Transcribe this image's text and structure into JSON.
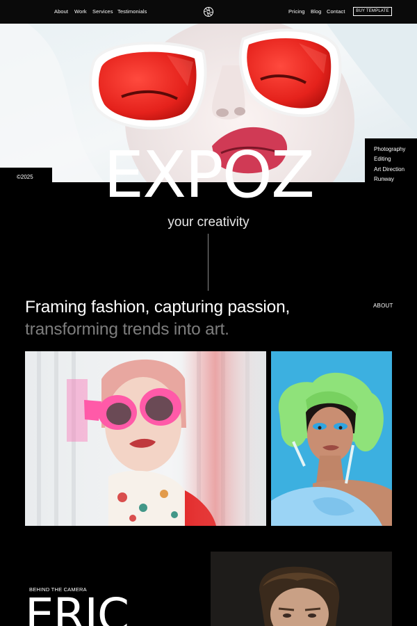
{
  "nav": {
    "left": [
      "About",
      "Work",
      "Services",
      "Testimonials"
    ],
    "right": [
      "Pricing",
      "Blog",
      "Contact"
    ],
    "cta": "BUY TEMPLATE",
    "logo_icon": "aperture-icon"
  },
  "hero": {
    "year": "©2025",
    "categories": [
      "Photography",
      "Editing",
      "Art Direction",
      "Runway"
    ],
    "brand": "EXPOZ",
    "tagline": "your creativity"
  },
  "about": {
    "headline_line1": "Framing fashion, capturing passion,",
    "headline_line2": "transforming trends into art.",
    "link": "ABOUT"
  },
  "behind": {
    "label": "BEHIND THE CAMERA",
    "name": "ERIC"
  },
  "colors": {
    "background": "#000000",
    "accent_red": "#e8322b",
    "muted_text": "#7d7d7d",
    "pink": "#ff5aa8",
    "sky_blue": "#3cb0e0",
    "lime": "#8fe27a"
  }
}
